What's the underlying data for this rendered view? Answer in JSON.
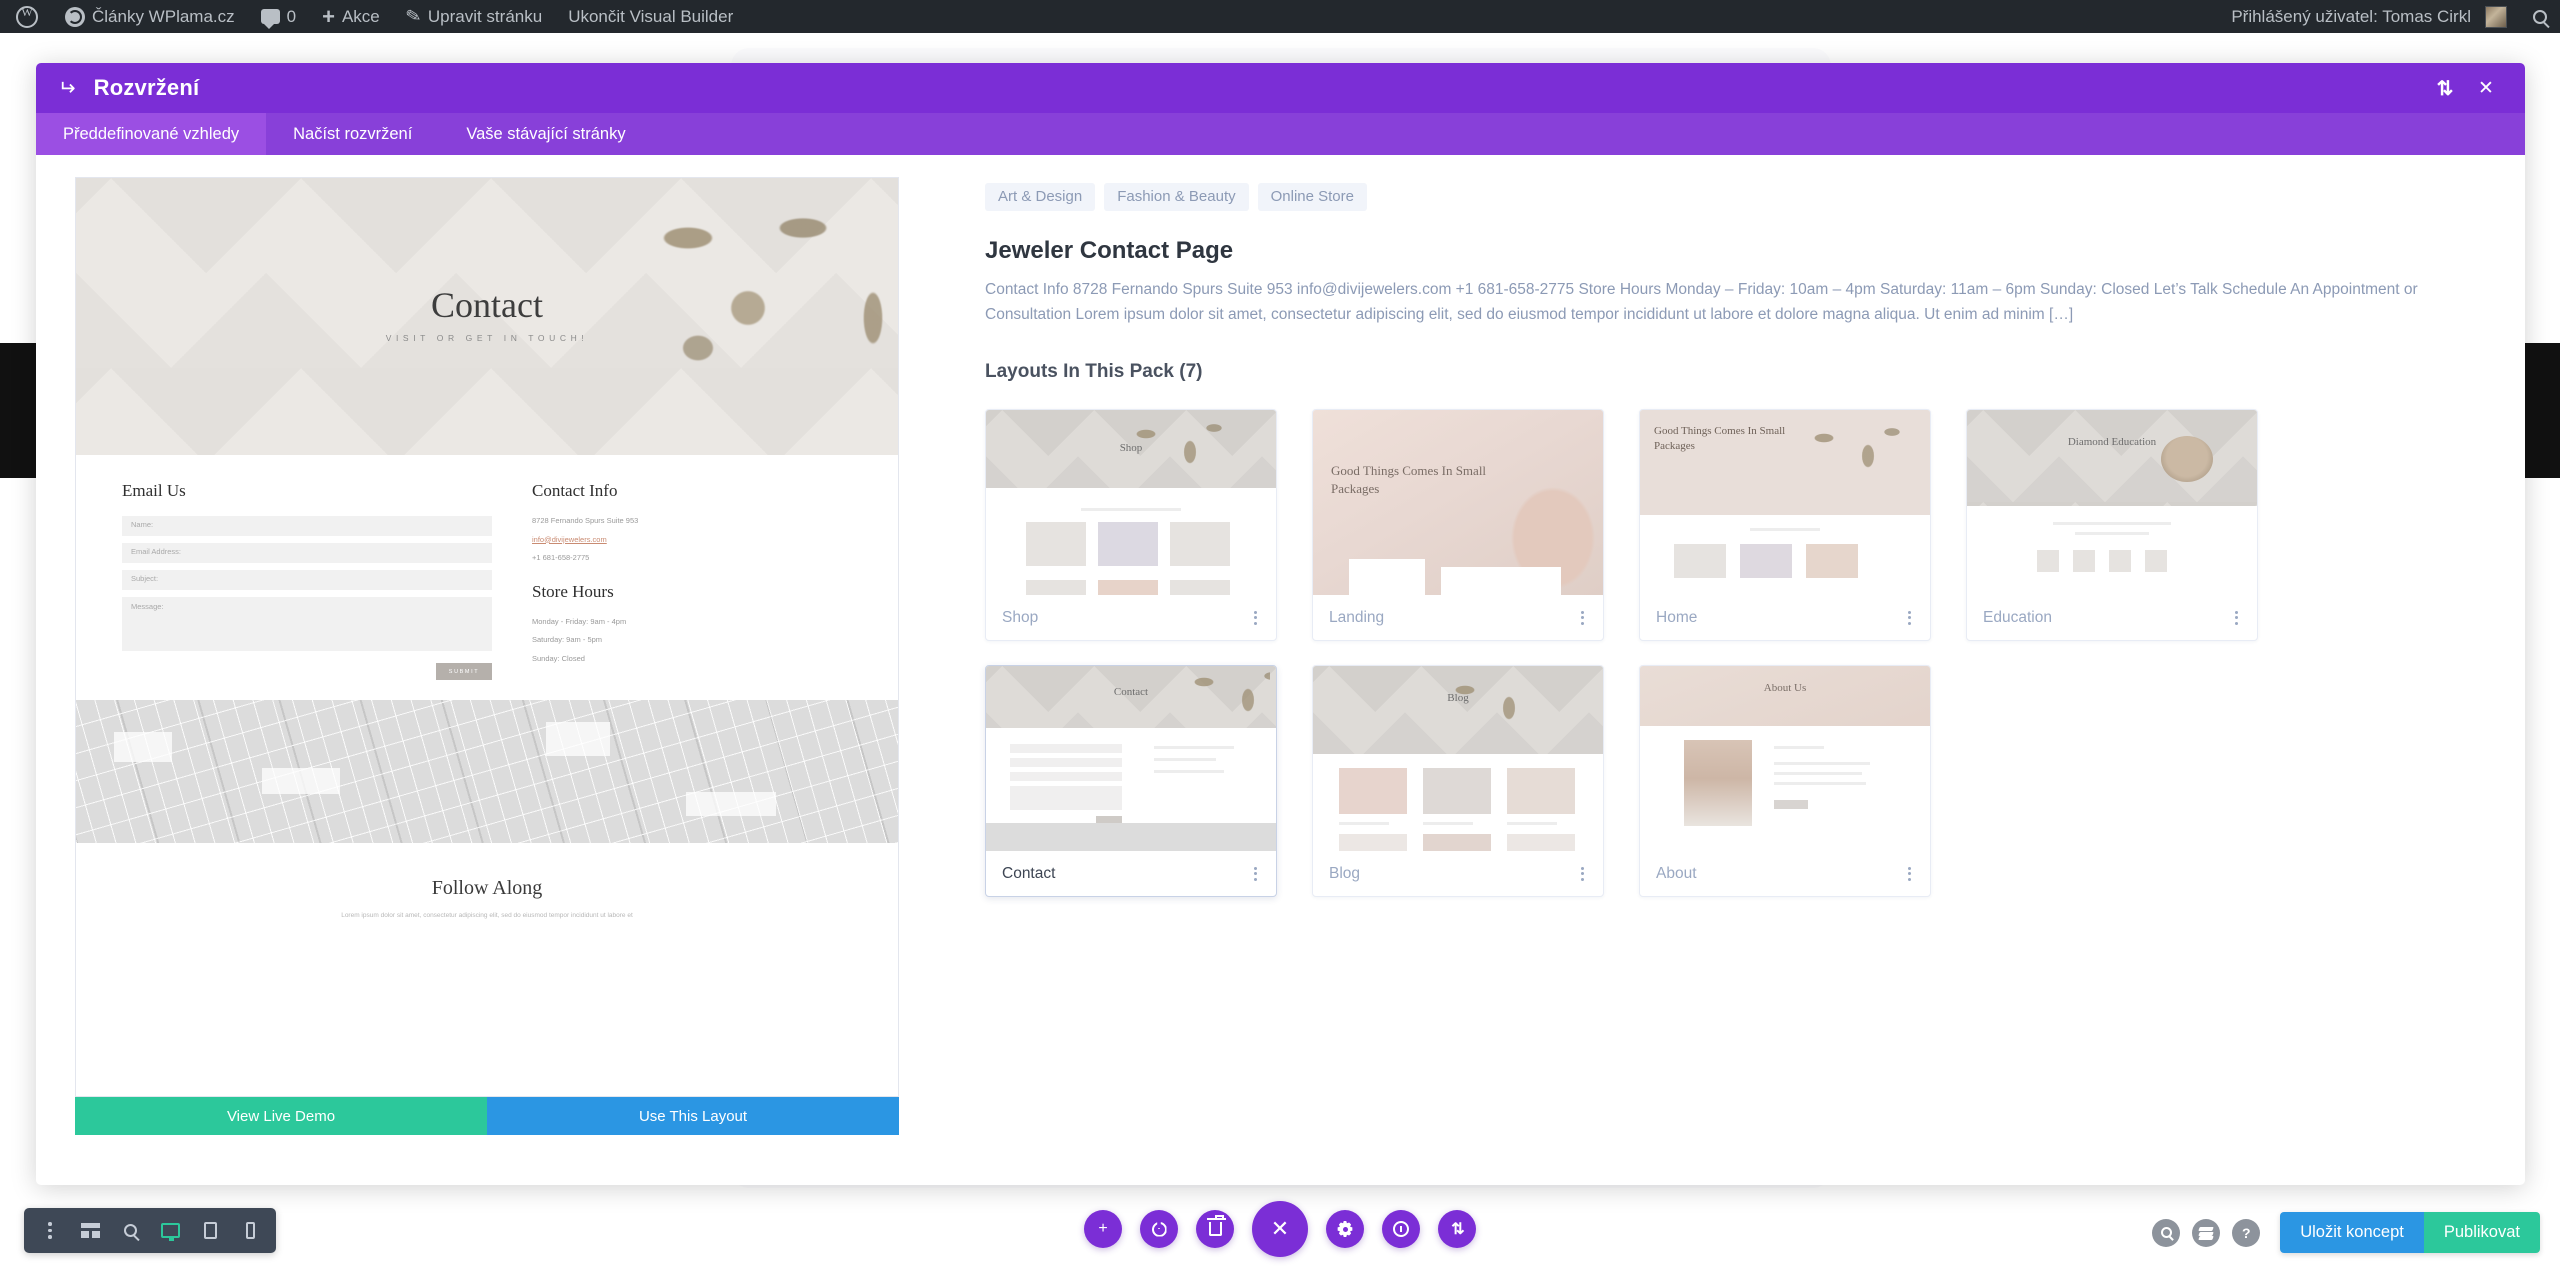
{
  "admin_bar": {
    "items": [
      {
        "icon": "wordpress-logo-icon",
        "label": ""
      },
      {
        "icon": "site-dashboard-icon",
        "label": "Články WPlama.cz"
      },
      {
        "icon": "comment-icon",
        "label": "0"
      },
      {
        "icon": "plus-icon",
        "label": "Akce"
      },
      {
        "icon": "pencil-icon",
        "label": "Upravit stránku"
      },
      {
        "icon": "",
        "label": "Ukončit Visual Builder"
      }
    ],
    "user_label": "Přihlášený uživatel: Tomas Cirkl",
    "search_icon": "search-icon"
  },
  "modal": {
    "back_icon": "back-arrow-icon",
    "title": "Rozvržení",
    "sort_icon": "sort-updown-icon",
    "close_icon": "close-icon",
    "tabs": [
      {
        "label": "Předdefinované vzhledy",
        "active": true
      },
      {
        "label": "Načíst rozvržení",
        "active": false
      },
      {
        "label": "Vaše stávající stránky",
        "active": false
      }
    ]
  },
  "preview": {
    "hero": {
      "title": "Contact",
      "subtitle": "VISIT OR GET IN TOUCH!"
    },
    "form": {
      "heading": "Email Us",
      "fields": [
        "Name:",
        "Email Address:",
        "Subject:",
        "Message:"
      ],
      "submit_label": "SUBMIT"
    },
    "contact_info": {
      "heading": "Contact Info",
      "lines": [
        "8728 Fernando Spurs Suite 953",
        "info@divijewelers.com",
        "+1 681-658-2775"
      ]
    },
    "store_hours": {
      "heading": "Store Hours",
      "lines": [
        "Monday - Friday: 9am - 4pm",
        "Saturday: 9am - 5pm",
        "Sunday: Closed"
      ]
    },
    "follow": {
      "title": "Follow Along",
      "subtitle": "Lorem ipsum dolor sit amet, consectetur adipiscing elit, sed do eiusmod tempor incididunt ut labore et"
    },
    "buttons": {
      "demo_label": "View Live Demo",
      "use_label": "Use This Layout"
    }
  },
  "details": {
    "tags": [
      "Art & Design",
      "Fashion & Beauty",
      "Online Store"
    ],
    "pack_title": "Jeweler Contact Page",
    "pack_description": "Contact Info 8728 Fernando Spurs Suite 953 info@divijewelers.com +1 681-658-2775 Store Hours Monday – Friday: 10am – 4pm Saturday: 11am – 6pm Sunday: Closed Let’s Talk Schedule An Appointment or Consultation Lorem ipsum dolor sit amet, consectetur adipiscing elit, sed do eiusmod tempor incididunt ut labore et dolore magna aliqua. Ut enim ad minim […]",
    "layouts_heading": "Layouts In This Pack (7)",
    "cards": [
      {
        "label": "Shop",
        "active": false,
        "thumb": "shop",
        "thumb_caption": "Shop"
      },
      {
        "label": "Landing",
        "active": false,
        "thumb": "landing",
        "thumb_caption": "Good Things Comes In Small Packages"
      },
      {
        "label": "Home",
        "active": false,
        "thumb": "home",
        "thumb_caption": "Good Things Comes In Small Packages"
      },
      {
        "label": "Education",
        "active": false,
        "thumb": "education",
        "thumb_caption": "Diamond Education"
      },
      {
        "label": "Contact",
        "active": true,
        "thumb": "contact",
        "thumb_caption": "Contact"
      },
      {
        "label": "Blog",
        "active": false,
        "thumb": "blog",
        "thumb_caption": "Blog"
      },
      {
        "label": "About",
        "active": false,
        "thumb": "about",
        "thumb_caption": "About Us"
      }
    ],
    "kebab_icon": "more-options-icon"
  },
  "bottom_left_toolbar": {
    "items": [
      {
        "icon": "kebab-menu-icon",
        "active": false
      },
      {
        "icon": "wireframe-icon",
        "active": false
      },
      {
        "icon": "zoom-icon",
        "active": false
      },
      {
        "icon": "desktop-view-icon",
        "active": true
      },
      {
        "icon": "tablet-view-icon",
        "active": false
      },
      {
        "icon": "phone-view-icon",
        "active": false
      }
    ]
  },
  "bottom_center_toolbar": {
    "items": [
      {
        "icon": "add-icon"
      },
      {
        "icon": "power-icon"
      },
      {
        "icon": "trash-icon"
      },
      {
        "icon": "close-icon",
        "primary": true
      },
      {
        "icon": "gear-icon"
      },
      {
        "icon": "history-icon"
      },
      {
        "icon": "sort-updown-icon"
      }
    ]
  },
  "bottom_right_toolbar": {
    "icons": [
      {
        "icon": "zoom-icon"
      },
      {
        "icon": "layers-icon"
      },
      {
        "icon": "help-icon",
        "glyph": "?"
      }
    ],
    "save_draft_label": "Uložit koncept",
    "publish_label": "Publikovat"
  },
  "colors": {
    "accent_purple": "#7b2ed6",
    "tab_purple": "#8840d9",
    "tab_active_purple": "#9b4fe3",
    "green": "#2cc89b",
    "blue": "#2b96e3",
    "admin_bar": "#23282d",
    "toolbar_dark": "#3e4856"
  }
}
